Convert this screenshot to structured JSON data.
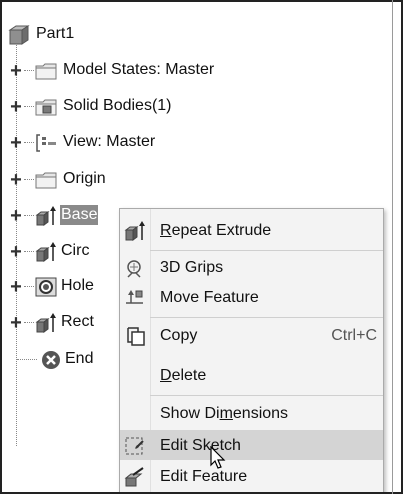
{
  "tree": {
    "root": {
      "label": "Part1",
      "icon": "part-cube-icon"
    },
    "items": [
      {
        "label": "Model States: Master",
        "icon": "folder-icon"
      },
      {
        "label": "Solid Bodies(1)",
        "icon": "solid-bodies-folder-icon"
      },
      {
        "label": "View: Master",
        "icon": "view-icon"
      },
      {
        "label": "Origin",
        "icon": "folder-icon"
      },
      {
        "label": "Base",
        "icon": "extrude-feature-icon",
        "selected": true
      },
      {
        "label": "Circ",
        "icon": "extrude-feature-icon"
      },
      {
        "label": "Hole",
        "icon": "hole-feature-icon"
      },
      {
        "label": "Rect",
        "icon": "extrude-feature-icon"
      },
      {
        "label": "End",
        "icon": "end-of-part-icon"
      }
    ]
  },
  "menu": {
    "items": [
      {
        "pre": "",
        "u": "R",
        "post": "epeat Extrude",
        "shortcut": "",
        "icon": "extrude-icon"
      },
      {
        "pre": "3D Grips",
        "u": "",
        "post": "",
        "shortcut": "",
        "icon": "3d-grips-icon"
      },
      {
        "pre": "Move Feature",
        "u": "",
        "post": "",
        "shortcut": "",
        "icon": "move-feature-icon"
      },
      {
        "pre": "Copy",
        "u": "",
        "post": "",
        "shortcut": "Ctrl+C",
        "icon": "copy-icon"
      },
      {
        "pre": "",
        "u": "D",
        "post": "elete",
        "shortcut": "",
        "icon": ""
      },
      {
        "pre": "Show Di",
        "u": "m",
        "post": "ensions",
        "shortcut": "",
        "icon": ""
      },
      {
        "pre": "Edit Sketch",
        "u": "",
        "post": "",
        "shortcut": "",
        "icon": "edit-sketch-icon"
      },
      {
        "pre": "Edit Feature",
        "u": "",
        "post": "",
        "shortcut": "",
        "icon": "edit-feature-icon"
      }
    ],
    "highlighted_index": 6
  },
  "cursor": {
    "icon": "mouse-pointer-icon"
  }
}
